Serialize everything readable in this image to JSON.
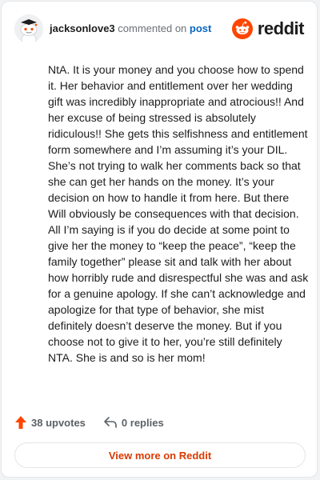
{
  "comment": {
    "username": "jacksonlove3",
    "action_text": "commented on",
    "target_text": "post",
    "body": "NtA. It is your money and you choose how to spend it. Her behavior and entitlement over her wedding gift was incredibly inappropriate and atrocious!! And her excuse of being stressed is absolutely ridiculous!! She gets this selfishness and entitlement form somewhere and I’m assuming it’s your DIL. She’s not trying to walk her comments back so that she can get her hands on the money. It’s your decision on how to handle it from here. But there Will obviously be consequences with that decision. All I’m saying is if you do decide at some point to give her the money to “keep the peace”, “keep the family together” please sit and talk with her about how horribly rude and disrespectful she was and ask for a genuine apology. If she can’t acknowledge and apologize for that type of behavior, she mist definitely doesn’t deserve the money. But if you choose not to give it to her, you’re still definitely NTA. She is and so is her mom!"
  },
  "brand": {
    "wordmark": "reddit",
    "icon": "reddit-logo-icon",
    "color": "#ff4500"
  },
  "footer": {
    "upvotes_label": "38 upvotes",
    "replies_label": "0 replies",
    "upvote_icon": "upvote-arrow-icon",
    "reply_icon": "reply-arrow-icon",
    "view_more_label": "View more on Reddit"
  },
  "colors": {
    "accent": "#ff4500",
    "link": "#0a66c2",
    "cta_text": "#d93a00"
  }
}
